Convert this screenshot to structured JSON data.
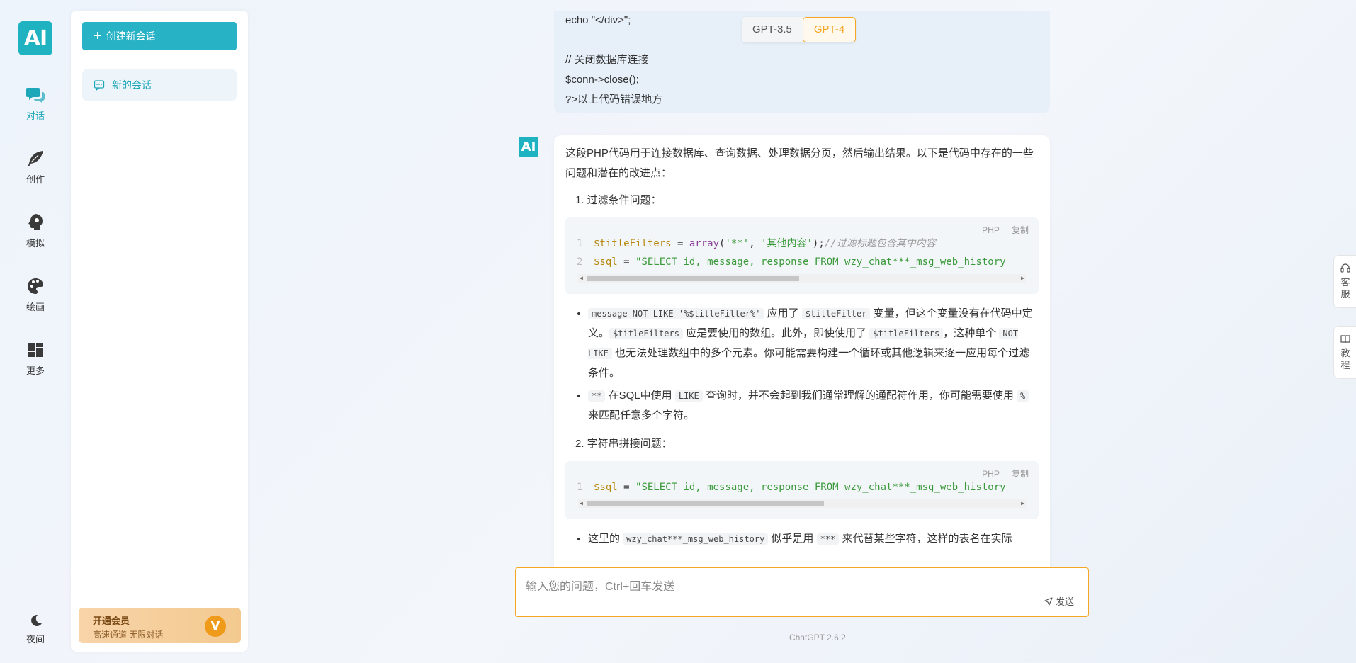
{
  "app": {
    "logo_text": "AI"
  },
  "rail": {
    "chat": "对话",
    "create": "创作",
    "simulate": "模拟",
    "draw": "绘画",
    "more": "更多",
    "night": "夜间"
  },
  "sidebar": {
    "new_chat": "创建新会话",
    "conversation": "新的会话",
    "vip_title": "开通会员",
    "vip_sub": "高速通道 无限对话",
    "vip_badge": "V"
  },
  "model_toggle": {
    "gpt35": "GPT-3.5",
    "gpt4": "GPT-4",
    "active": "GPT-4"
  },
  "user_message": {
    "lines": [
      "echo \"</div>\";",
      "",
      "// 关闭数据库连接",
      "$conn->close();",
      "?>以上代码错误地方"
    ]
  },
  "ai_message": {
    "avatar": "AI",
    "intro": "这段PHP代码用于连接数据库、查询数据、处理数据分页，然后输出结果。以下是代码中存在的一些问题和潜在的改进点：",
    "item1": "1. 过滤条件问题：",
    "code1": {
      "lang": "PHP",
      "copy": "复制",
      "line_nums": [
        "1",
        "2"
      ],
      "l1_var": "$titleFilters",
      "l1_eq": " = ",
      "l1_fn": "array",
      "l1_open": "(",
      "l1_s1": "'**'",
      "l1_comma": ", ",
      "l1_s2": "'其他内容'",
      "l1_close": ");",
      "l1_comment": "//过滤标题包含其中内容",
      "l2_var": "$sql",
      "l2_eq": " = ",
      "l2_str": "\"SELECT id, message, response FROM wzy_chat***_msg_web_history"
    },
    "b1": {
      "c1": "message NOT LIKE '%$titleFilter%'",
      "t1": " 应用了 ",
      "c2": "$titleFilter",
      "t2": " 变量，但这个变量没有在代码中定义。",
      "c3": "$titleFilters",
      "t3": " 应是要使用的数组。此外，即使使用了 ",
      "c4": "$titleFilters",
      "t4": "，这种单个 ",
      "c5": "NOT LIKE",
      "t5": " 也无法处理数组中的多个元素。你可能需要构建一个循环或其他逻辑来逐一应用每个过滤条件。"
    },
    "b2": {
      "c1": "**",
      "t1": " 在SQL中使用 ",
      "c2": "LIKE",
      "t2": " 查询时，并不会起到我们通常理解的通配符作用，你可能需要使用 ",
      "c3": "%",
      "t3": " 来匹配任意多个字符。"
    },
    "item2": "2. 字符串拼接问题：",
    "code2": {
      "lang": "PHP",
      "copy": "复制",
      "line_nums": [
        "1"
      ],
      "l1_var": "$sql",
      "l1_eq": " = ",
      "l1_str": "\"SELECT id, message, response FROM wzy_chat***_msg_web_history"
    },
    "b3": {
      "t1": "这里的 ",
      "c1": "wzy_chat***_msg_web_history",
      "t2": " 似乎是用 ",
      "c2": "***",
      "t3": " 来代替某些字符，这样的表名在实际"
    }
  },
  "input": {
    "placeholder": "输入您的问题，Ctrl+回车发送",
    "value": "",
    "send": "发送"
  },
  "footer": {
    "version": "ChatGPT 2.6.2"
  },
  "float_tabs": {
    "service": [
      "客",
      "服"
    ],
    "tutorial": [
      "教",
      "程"
    ]
  },
  "colors": {
    "accent": "#1fb3c1",
    "highlight": "#f5a623"
  }
}
